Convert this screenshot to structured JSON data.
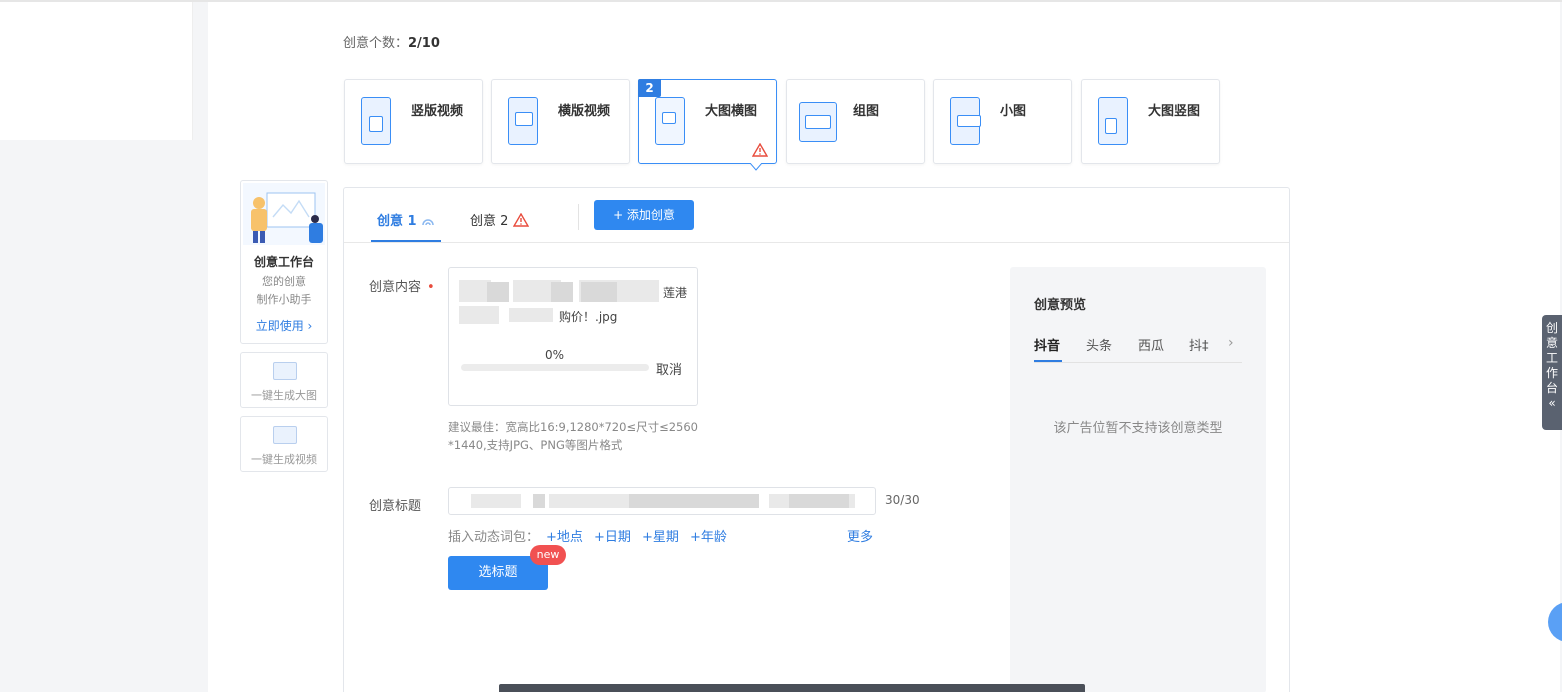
{
  "header": {
    "count_label": "创意个数：",
    "count_value": "2/10"
  },
  "creative_types": [
    {
      "label": "竖版视频",
      "icon": "vertical-video-icon"
    },
    {
      "label": "横版视频",
      "icon": "horizontal-video-icon"
    },
    {
      "label": "大图横图",
      "icon": "large-horizontal-image-icon",
      "badge": "2",
      "selected": true,
      "warning": true
    },
    {
      "label": "组图",
      "icon": "image-group-icon"
    },
    {
      "label": "小图",
      "icon": "small-image-icon"
    },
    {
      "label": "大图竖图",
      "icon": "large-vertical-image-icon"
    }
  ],
  "assistant": {
    "title": "创意工作台",
    "line1": "您的创意",
    "line2": "制作小助手",
    "link": "立即使用 ›"
  },
  "generators": [
    {
      "label": "一键生成大图"
    },
    {
      "label": "一键生成视频"
    }
  ],
  "editor": {
    "tabs": [
      {
        "label": "创意 1"
      },
      {
        "label": "创意 2"
      }
    ],
    "add_button": "+ 添加创意",
    "content": {
      "label": "创意内容",
      "file_name_part1": "莲港",
      "file_name_part2": "购价！.jpg",
      "progress_text": "0%",
      "progress": 0,
      "cancel": "取消",
      "hint_line1": "建议最佳：宽高比16:9,1280*720≤尺寸≤2560",
      "hint_line2": "*1440,支持JPG、PNG等图片格式"
    },
    "title_field": {
      "label": "创意标题",
      "counter": "30/30",
      "dynamic_label": "插入动态词包：",
      "dynamic_words": [
        "+地点",
        "+日期",
        "+星期",
        "+年龄"
      ],
      "more": "更多",
      "pick_button": "选标题",
      "new_badge": "new"
    },
    "preview": {
      "title": "创意预览",
      "tabs": [
        "抖音",
        "头条",
        "西瓜",
        "抖‡"
      ],
      "message": "该广告位暂不支持该创意类型"
    }
  },
  "side_tab": {
    "label": "创意工作台",
    "arrow": "«"
  },
  "colors": {
    "accent": "#2f88f0",
    "warning": "#e84c3d"
  }
}
